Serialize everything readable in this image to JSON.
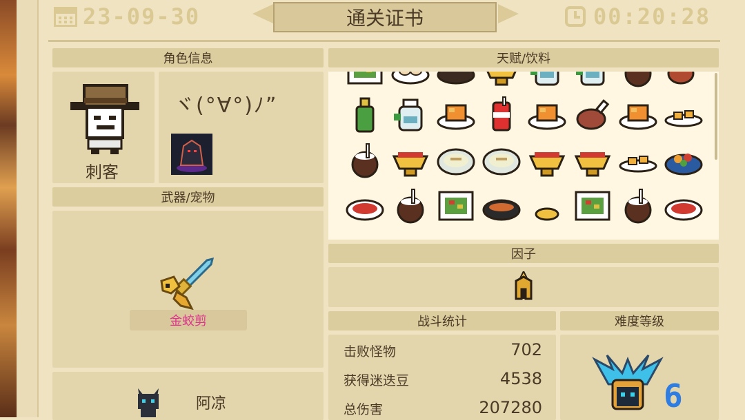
{
  "header": {
    "date": "23-09-30",
    "title": "通关证书",
    "time": "00:20:28"
  },
  "character": {
    "section_title": "角色信息",
    "role_name": "刺客",
    "emote": "ヾ(°∀°)ﾉ”",
    "skin_icon": "dark-hooded-character-icon"
  },
  "weapon": {
    "section_title": "武器/宠物",
    "name": "金蛟剪",
    "name_color": "#e0338f"
  },
  "pet": {
    "name": "阿凉",
    "icon": "black-cat-icon"
  },
  "talents": {
    "section_title": "天赋/饮料",
    "items": [
      "salad-plate",
      "dumpling-plate",
      "roast-chicken",
      "gold-bowl",
      "potion-bottle",
      "potion-bottle",
      "coconut-drink",
      "meat-leg",
      "green-bottle",
      "potion-bottle",
      "cake-plate",
      "soda-can",
      "cake-plate",
      "steak",
      "cake-plate",
      "cookie-plate",
      "coconut-drink",
      "gold-bowl",
      "noodle-bowl",
      "noodle-bowl",
      "gold-bowl",
      "gold-bowl",
      "cookie-plate",
      "fruit-bowl",
      "red-plate",
      "coconut-drink",
      "salad-plate",
      "soup-bowl",
      "small-bowl",
      "salad-plate",
      "coconut-drink",
      "red-plate"
    ]
  },
  "factor": {
    "section_title": "因子",
    "icon": "spartan-helmet-icon"
  },
  "battle_stats": {
    "section_title": "战斗统计",
    "rows": [
      {
        "label": "击败怪物",
        "value": "702"
      },
      {
        "label": "获得迷迭豆",
        "value": "4538"
      },
      {
        "label": "总伤害",
        "value": "207280"
      }
    ]
  },
  "difficulty": {
    "section_title": "难度等级",
    "level": "6",
    "icon": "winged-demon-badge-icon",
    "level_color": "#2f7de0"
  }
}
